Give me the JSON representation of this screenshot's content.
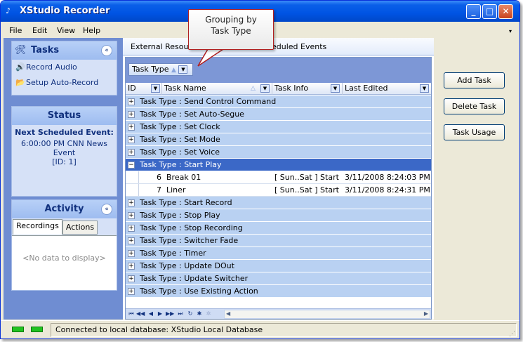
{
  "window": {
    "title": "XStudio Recorder"
  },
  "menu": [
    "File",
    "Edit",
    "View",
    "Help"
  ],
  "tasks_box": {
    "title": "Tasks",
    "items": [
      "Record Audio",
      "Setup Auto-Record"
    ]
  },
  "status_box": {
    "title": "Status",
    "heading": "Next Scheduled Event:",
    "line1": "6:00:00 PM CNN News Event",
    "line2": "[ID: 1]"
  },
  "activity_box": {
    "title": "Activity",
    "tabs": [
      "Recordings",
      "Actions"
    ],
    "empty": "<No data to display>"
  },
  "center_tabs": [
    "External Resource",
    "eduled Events"
  ],
  "group_by": {
    "label": "Task Type",
    "sort_icon": "sort-ascending-icon"
  },
  "columns": [
    "ID",
    "Task Name",
    "Task Info",
    "Last Edited"
  ],
  "groups_before": [
    "Task Type : Send Control Command",
    "Task Type : Set Auto-Segue",
    "Task Type : Set Clock",
    "Task Type : Set Mode",
    "Task Type : Set Voice"
  ],
  "expanded_group": {
    "label": "Task Type : Start Play",
    "rows": [
      {
        "id": "6",
        "name": "Break 01",
        "info": "[ Sun..Sat ] Start",
        "edited": "3/11/2008 8:24:03 PM"
      },
      {
        "id": "7",
        "name": "Liner",
        "info": "[ Sun..Sat ] Start",
        "edited": "3/11/2008 8:24:31 PM"
      }
    ]
  },
  "groups_after": [
    "Task Type : Start Record",
    "Task Type : Stop Play",
    "Task Type : Stop Recording",
    "Task Type : Switcher Fade",
    "Task Type : Timer",
    "Task Type : Update DOut",
    "Task Type : Update Switcher",
    "Task Type : Use Existing Action"
  ],
  "buttons": {
    "add": "Add Task",
    "delete": "Delete Task",
    "usage": "Task Usage"
  },
  "statusbar": {
    "text": "Connected to local database: XStudio Local Database"
  },
  "callout": {
    "line1": "Grouping by",
    "line2": "Task Type"
  },
  "colors": {
    "titlebar": "#0054e3",
    "group_row": "#b9d1f2",
    "selected_row": "#3b68c7",
    "led": "#21c321"
  }
}
